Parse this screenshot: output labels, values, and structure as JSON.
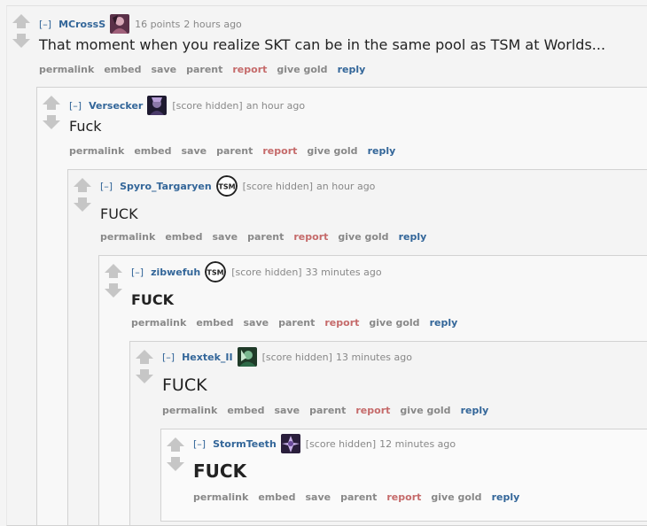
{
  "comments": [
    {
      "toggle": "[–]",
      "author": "MCrossS",
      "score": "16 points",
      "time": "2 hours ago",
      "body": "That moment when you realize SKT can be in the same pool as TSM at Worlds...",
      "flair": "avatar-purple"
    },
    {
      "toggle": "[–]",
      "author": "Versecker",
      "score": "[score hidden]",
      "time": "an hour ago",
      "body": "Fuck",
      "flair": "avatar-dark"
    },
    {
      "toggle": "[–]",
      "author": "Spyro_Targaryen",
      "score": "[score hidden]",
      "time": "an hour ago",
      "body": "FUCK",
      "flair": "tsm-logo"
    },
    {
      "toggle": "[–]",
      "author": "zibwefuh",
      "score": "[score hidden]",
      "time": "33 minutes ago",
      "body": "FUCK",
      "flair": "tsm-logo"
    },
    {
      "toggle": "[–]",
      "author": "Hextek_II",
      "score": "[score hidden]",
      "time": "13 minutes ago",
      "body": "FUCK",
      "flair": "avatar-green"
    },
    {
      "toggle": "[–]",
      "author": "StormTeeth",
      "score": "[score hidden]",
      "time": "12 minutes ago",
      "body": "FUCK",
      "flair": "avatar-violet"
    }
  ],
  "actions": {
    "permalink": "permalink",
    "embed": "embed",
    "save": "save",
    "parent": "parent",
    "report": "report",
    "give_gold": "give gold",
    "reply": "reply"
  },
  "colors": {
    "link": "#336699",
    "report": "#c56a6a",
    "meta": "#888888",
    "text": "#222222"
  }
}
